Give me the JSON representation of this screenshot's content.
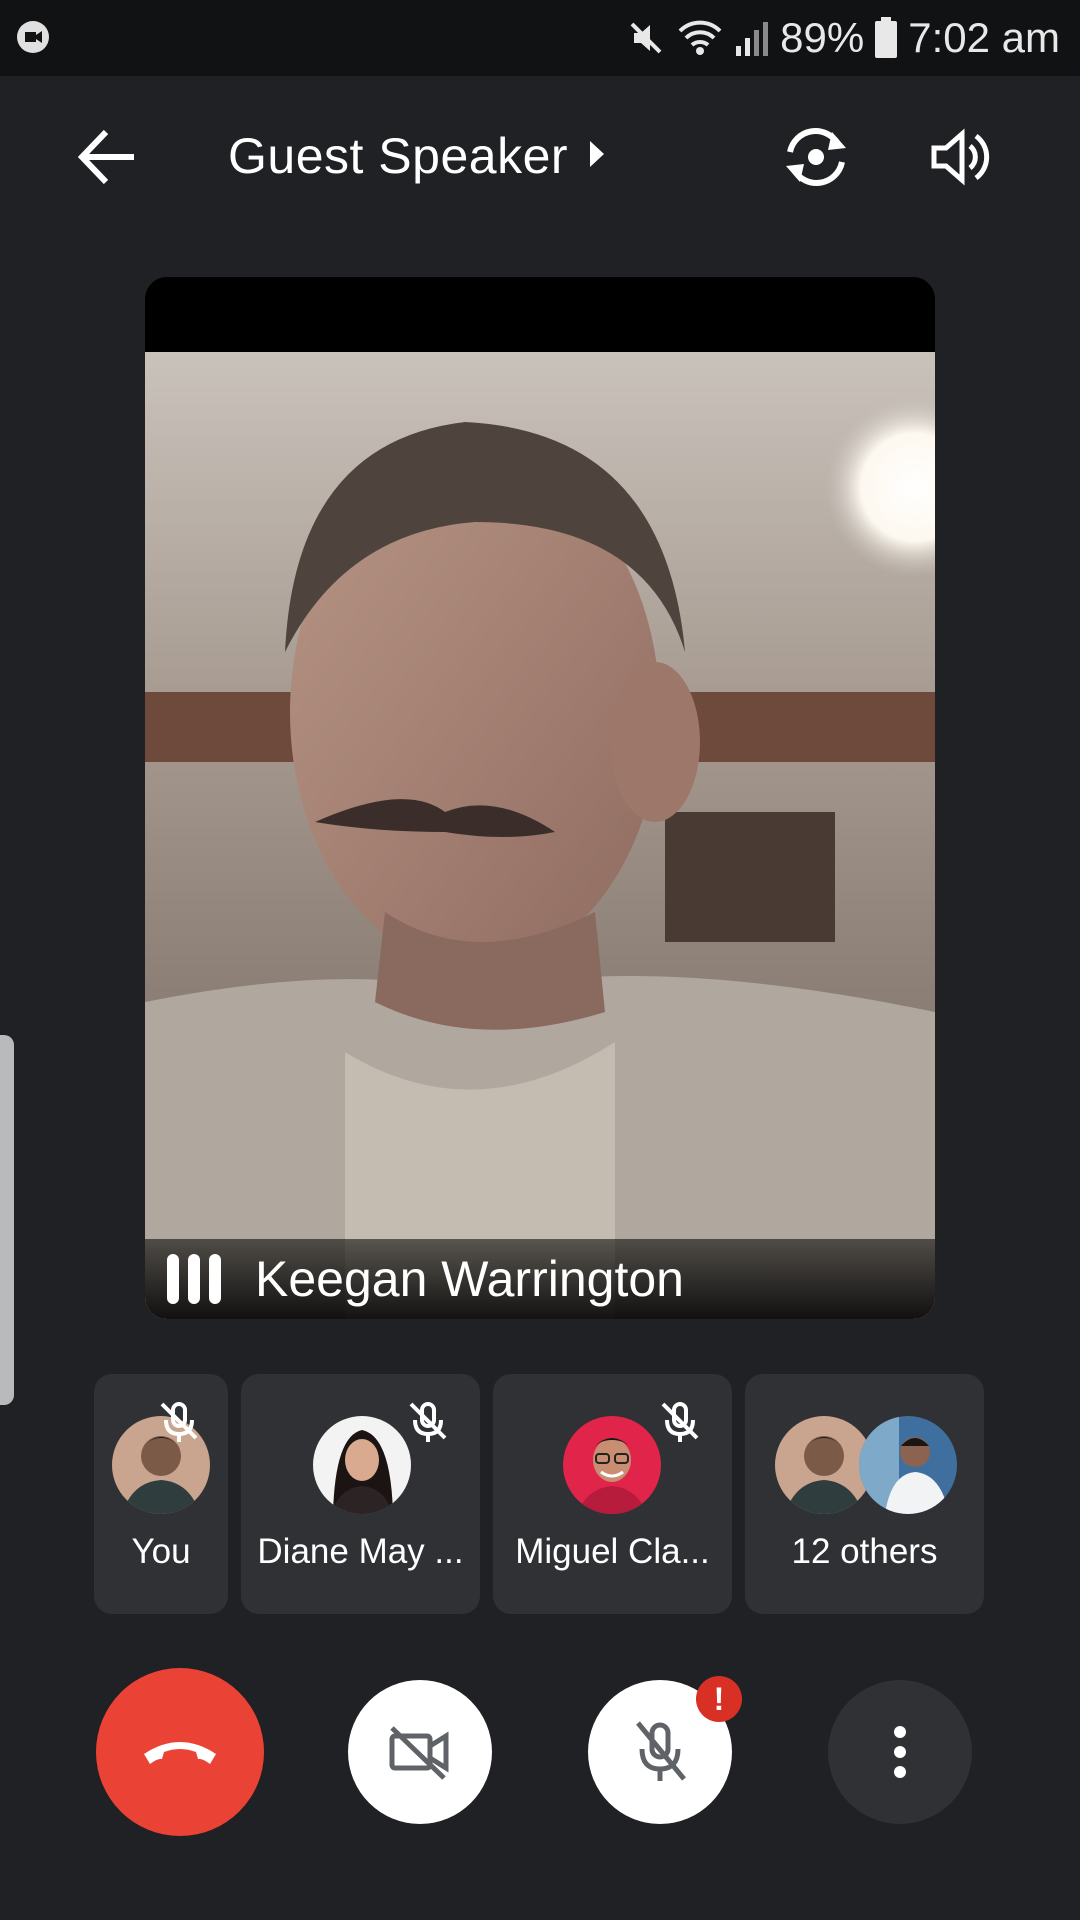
{
  "status_bar": {
    "battery_percent": "89%",
    "time": "7:02 am",
    "icons": [
      "meet-notification-icon",
      "mute-icon",
      "wifi-icon",
      "signal-icon",
      "battery-icon"
    ]
  },
  "top_bar": {
    "title": "Guest Speaker",
    "icons": [
      "back-arrow-icon",
      "caret-right-icon",
      "switch-camera-icon",
      "speaker-volume-icon"
    ]
  },
  "main_video": {
    "speaker_name": "Keegan Warrington",
    "icon": "audio-level-icon"
  },
  "participants": [
    {
      "label": "You",
      "muted": true
    },
    {
      "label": "Diane May ...",
      "muted": true
    },
    {
      "label": "Miguel Cla...",
      "muted": true
    },
    {
      "label": "12 others",
      "muted": false
    }
  ],
  "controls": {
    "end_call": "end-call-icon",
    "camera": "camera-off-icon",
    "microphone": "mic-off-icon",
    "alert_badge": "!",
    "more": "more-vert-icon"
  },
  "colors": {
    "background": "#202124",
    "status_bar": "#111214",
    "card": "#303134",
    "end_call": "#ea4335",
    "alert": "#d93025"
  }
}
